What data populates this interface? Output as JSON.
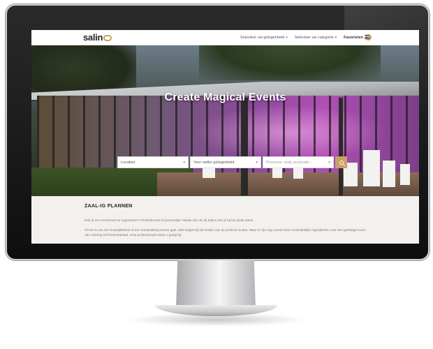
{
  "brand": {
    "logo_text": "salin",
    "accent": "#c7a167"
  },
  "header": {
    "nav": [
      {
        "label": "Selecteer uw gelegenheid",
        "icon": "chevron-down-icon"
      },
      {
        "label": "Selecteer uw categorie",
        "icon": "chevron-down-icon"
      }
    ],
    "favorites_label": "Favorieten",
    "favorites_count": "0",
    "menu_icon": "hamburger-menu-icon"
  },
  "hero": {
    "title": "Create Magical Events",
    "search": {
      "location_label": "Locaties",
      "occasion_label": "Voor welke gelegenheid",
      "place_placeholder": "Provincie, stad, postcode...",
      "button_icon": "search-icon"
    }
  },
  "content": {
    "heading": "ZAAL-IG PLANNEN",
    "paragraph1": "Heb je een evenement te organiseren? Professioneel of persoonlijk? Maakt niet uit, bij Salino ben je bij het juiste adres.",
    "paragraph2": "Of het nu om een huwelijksfeest of een teambuilding-sessie gaat, alles begint bij het vinden van de perfecte locatie. Maar er zijn nog zoveel meer noodzakelijke ingrediënten voor een geslaagd event. Van catering tot feestmateriaal, onze professionals staan u graag bij."
  }
}
